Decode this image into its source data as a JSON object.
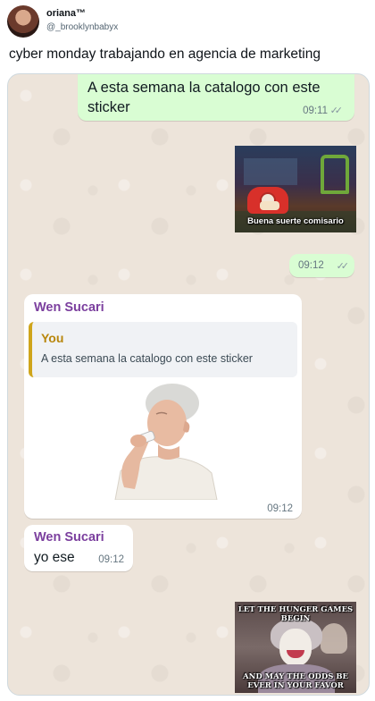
{
  "tweet": {
    "display_name": "oriana™",
    "handle": "@_brooklynbabyx",
    "text": "cyber monday trabajando en agencia de marketing"
  },
  "chat": {
    "messages": [
      {
        "direction": "outgoing",
        "text": "A esta semana la catalogo con este sticker",
        "time": "09:11",
        "status": "read"
      },
      {
        "direction": "outgoing",
        "type": "image",
        "caption": "Buena suerte comisario"
      },
      {
        "direction": "outgoing",
        "time": "09:12",
        "status": "read"
      },
      {
        "direction": "incoming",
        "sender": "Wen Sucari",
        "quote": {
          "sender": "You",
          "text": "A esta semana la catalogo con este sticker"
        },
        "type": "sticker",
        "time": "09:12"
      },
      {
        "direction": "incoming",
        "sender": "Wen Sucari",
        "text": "yo ese",
        "time": "09:12"
      },
      {
        "direction": "outgoing",
        "type": "image",
        "top_text": "LET THE HUNGER GAMES BEGIN",
        "bottom_text": "AND MAY THE ODDS BE EVER IN YOUR FAVOR"
      }
    ]
  },
  "colors": {
    "outgoing_bubble": "#d9fdd3",
    "incoming_bubble": "#ffffff",
    "sender_name": "#7b3f9e",
    "quote_bar": "#cfa51b",
    "chat_wallpaper": "#ede4da"
  },
  "icons": {
    "read_receipt": "double-check-icon"
  }
}
